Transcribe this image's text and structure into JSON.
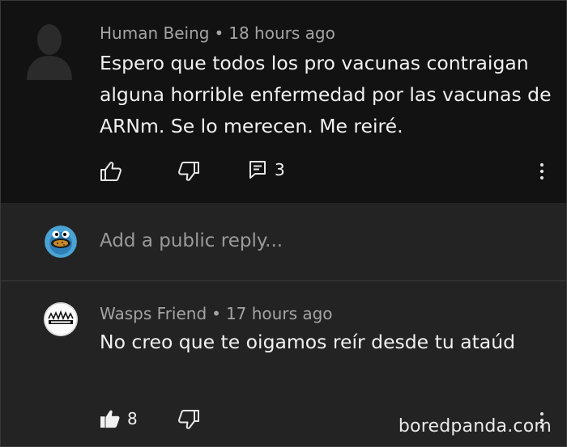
{
  "comments": [
    {
      "author": "Human Being",
      "separator": "•",
      "time": "18 hours ago",
      "text": "Espero que todos los pro vacunas contraigan alguna horrible enfermedad por las vacunas de ARNm. Se lo merecen. Me reiré.",
      "replies_count": "3",
      "avatar_icon": "user-silhouette-icon"
    },
    {
      "author": "Wasps Friend",
      "separator": "•",
      "time": "17 hours ago",
      "text": "No creo que te oigamos reír desde tu ataúd",
      "likes_count": "8",
      "avatar_icon": "wasps-friend-avatar"
    }
  ],
  "reply_input": {
    "placeholder": "Add a public reply..."
  },
  "watermark": "boredpanda.com"
}
